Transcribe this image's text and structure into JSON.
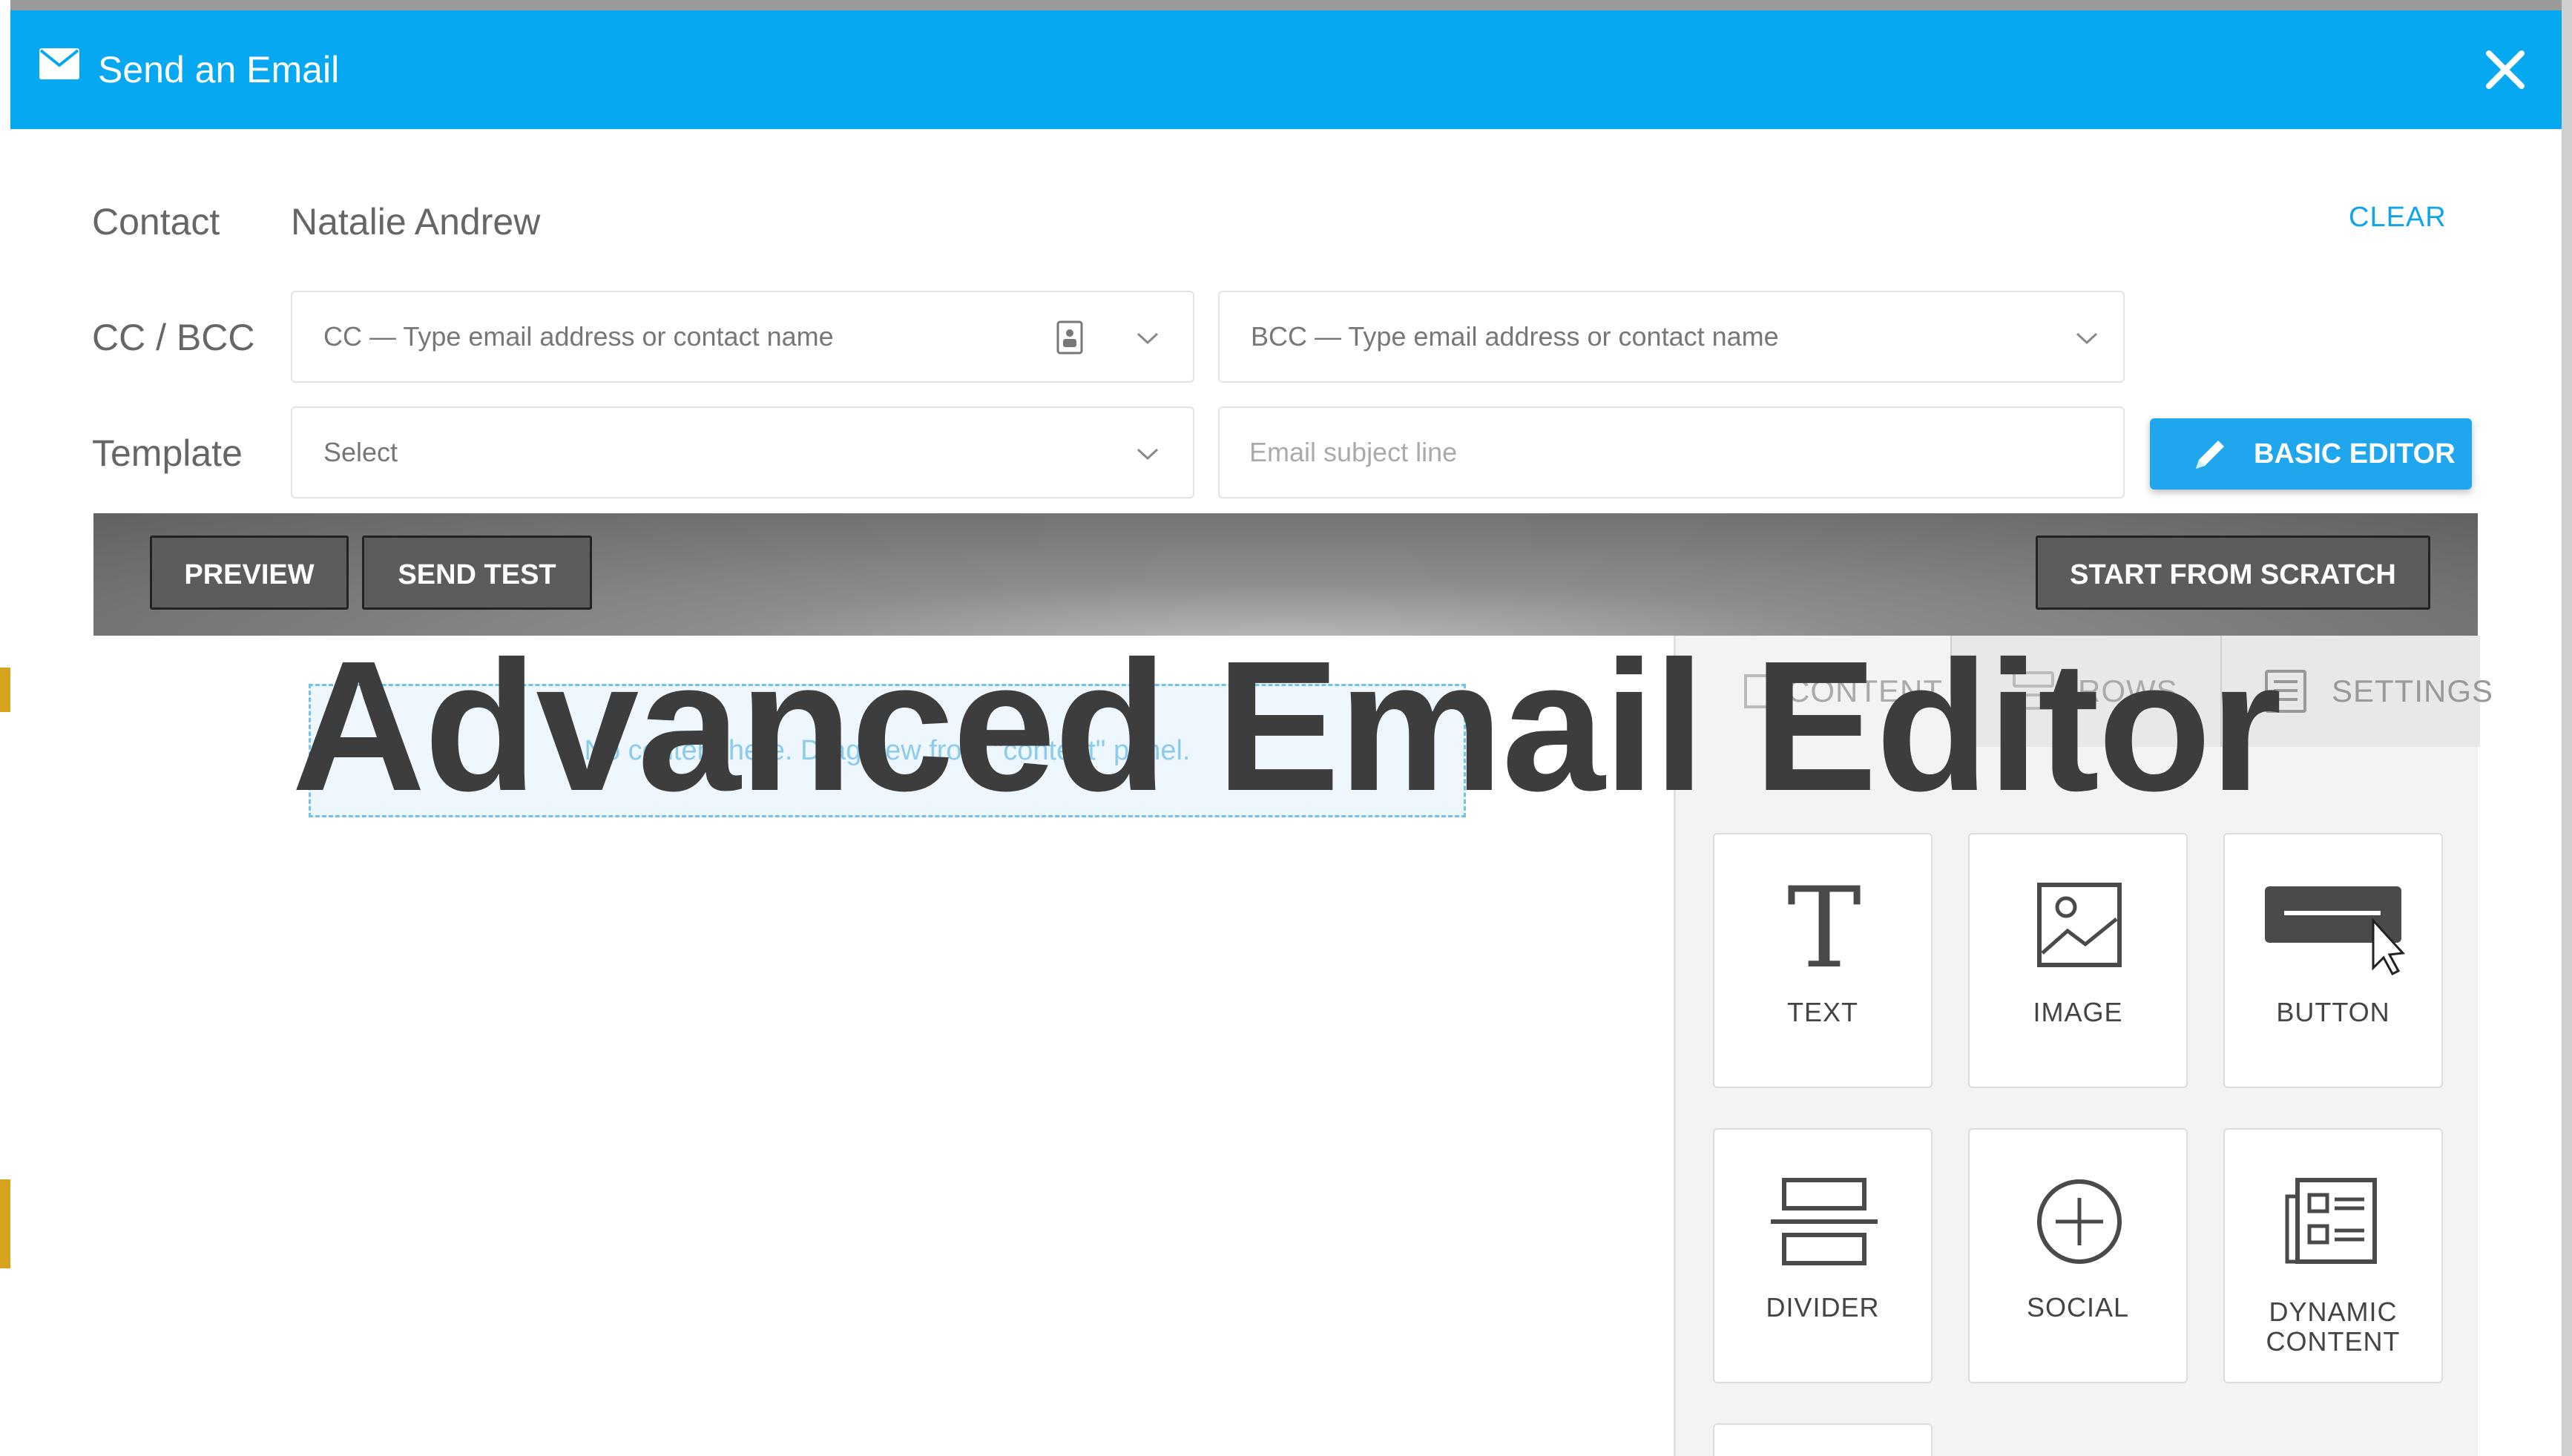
{
  "modal": {
    "title": "Send an Email"
  },
  "form": {
    "contact_label": "Contact",
    "contact_value": "Natalie Andrew",
    "clear_label": "CLEAR",
    "cc_label": "CC / BCC",
    "cc_placeholder": "CC — Type email address or contact name",
    "bcc_placeholder": "BCC — Type email address or contact name",
    "template_label": "Template",
    "template_value": "Select",
    "subject_placeholder": "Email subject line",
    "basic_editor_label": "BASIC EDITOR"
  },
  "toolbar": {
    "preview_label": "PREVIEW",
    "send_test_label": "SEND TEST",
    "start_from_scratch_label": "START FROM SCRATCH"
  },
  "canvas": {
    "drop_hint": "No content here. Drag new from \"content\" panel."
  },
  "panel": {
    "tabs": [
      "CONTENT",
      "ROWS",
      "SETTINGS"
    ],
    "blocks": [
      "TEXT",
      "IMAGE",
      "BUTTON",
      "DIVIDER",
      "SOCIAL",
      "DYNAMIC CONTENT"
    ]
  },
  "overlay": {
    "title": "Advanced Email Editor"
  },
  "colors": {
    "header_blue": "#05a8f1",
    "accent_blue": "#1fa6ec",
    "toolbar_dark": "#5f6163"
  }
}
